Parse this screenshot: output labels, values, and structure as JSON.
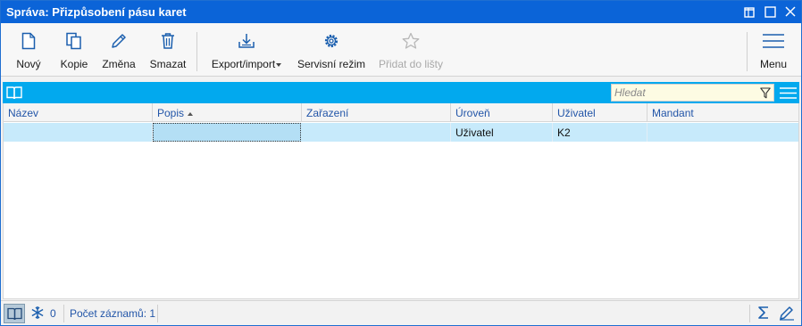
{
  "window": {
    "title": "Správa: Přizpůsobení pásu karet"
  },
  "toolbar": {
    "buttons": [
      {
        "label": "Nový",
        "icon": "new-document-icon"
      },
      {
        "label": "Kopie",
        "icon": "copy-icon"
      },
      {
        "label": "Změna",
        "icon": "pencil-icon"
      },
      {
        "label": "Smazat",
        "icon": "trash-icon"
      },
      {
        "label": "Export/import",
        "icon": "export-import-icon",
        "has_dropdown": true
      },
      {
        "label": "Servisní režim",
        "icon": "gear-icon"
      },
      {
        "label": "Přidat do lišty",
        "icon": "star-icon",
        "disabled": true
      }
    ],
    "menu_label": "Menu"
  },
  "search": {
    "placeholder": "Hledat"
  },
  "grid": {
    "columns": [
      "Název",
      "Popis",
      "Zařazení",
      "Úroveň",
      "Uživatel",
      "Mandant"
    ],
    "sorted_column": "Popis",
    "sort_direction": "ascending",
    "rows": [
      {
        "nazev": "",
        "popis": "",
        "zarazeni": "",
        "uroven": "Uživatel",
        "uzivatel": "K2",
        "mandant": ""
      }
    ]
  },
  "status": {
    "frozen_count": "0",
    "records": "Počet záznamů: 1"
  },
  "colors": {
    "title_bar": "#0b64d8",
    "grid_bar": "#02a9ee",
    "selected_row": "#c7eafb",
    "header_text": "#2255a8"
  }
}
